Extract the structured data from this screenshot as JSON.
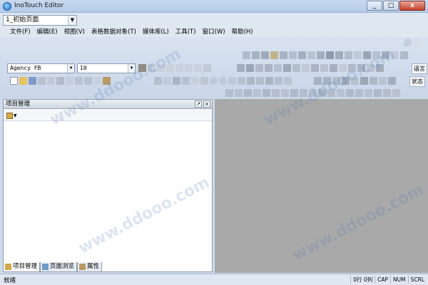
{
  "window": {
    "title": "InoTouch Editor",
    "minimize": "_",
    "maximize": "□",
    "close": "x"
  },
  "page_selector": {
    "value": "1_初始页面"
  },
  "menu": [
    "文件(F)",
    "编辑(E)",
    "视图(V)",
    "表格数据对象(T)",
    "媒体库(L)",
    "工具(T)",
    "窗口(W)",
    "帮助(H)"
  ],
  "toolbar": {
    "font_name": "Agency FB",
    "font_size": "10",
    "language_label": "语言",
    "state_label": "状态"
  },
  "project_panel": {
    "title": "项目管理",
    "tabs": [
      {
        "label": "项目管理",
        "icon": "project-icon"
      },
      {
        "label": "页面浏览",
        "icon": "page-browse-icon"
      },
      {
        "label": "属性",
        "icon": "properties-icon"
      }
    ]
  },
  "statusbar": {
    "ready": "就绪",
    "position": "0行 0列",
    "caps": "CAP",
    "num": "NUM",
    "scroll": "SCRL"
  },
  "watermark": "www.ddooo.com",
  "colors": {
    "titlebar": "#b4cbe8",
    "toolbar_bg": "#cfdaea",
    "workspace": "#a9a9a9",
    "panel_bg": "#ffffff"
  }
}
